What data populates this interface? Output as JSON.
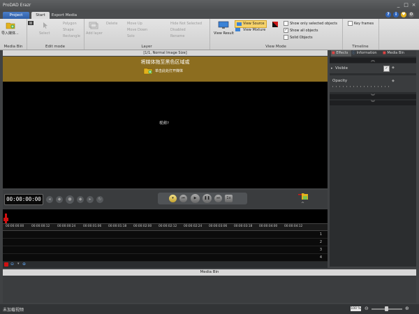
{
  "window": {
    "title": "ProDAD Erazr",
    "buttons": [
      "_",
      "□",
      "×"
    ]
  },
  "tabs": {
    "project": "Project",
    "start": "Start",
    "export": "Export Media"
  },
  "help_icons": [
    "?",
    "i",
    "♥",
    "⚙"
  ],
  "ribbon": {
    "media_bin": {
      "import": "导入媒体...",
      "title": "Media Bin"
    },
    "edit_mode": {
      "select": "Select",
      "polygon": "Polygon",
      "shape": "Shape",
      "rectangle": "Rectangle",
      "title": "Edit mode"
    },
    "layer": {
      "add_layer": "Add layer",
      "delete": "Delete",
      "move_up": "Move Up",
      "move_down": "Move Down",
      "solo": "Solo",
      "hide_all": "Hide Not Selected",
      "disabled": "Disabled",
      "rename": "Rename",
      "title": "Layer"
    },
    "view_mode": {
      "view_result": "View Result",
      "view_source": "View Source",
      "view_mixture": "View Mixture",
      "show_only_selected": "Show only selected objects",
      "show_all": "Show all objects",
      "solid_objects": "Solid Objects",
      "title": "View Mode"
    },
    "timeline": {
      "key_frames": "Key frames",
      "title": "Timeline"
    }
  },
  "preview": {
    "header": "[1/1, Normal Image Size]",
    "drop_text": "将媒体拖至黑色区域或",
    "open_media": "单击此处打开媒体",
    "video_label": "视频?"
  },
  "transport": {
    "timecode": "00:00:00:00",
    "speed_label": "1x"
  },
  "timeline": {
    "ticks": [
      "00:00:00:00",
      "00:00:00:12",
      "00:00:00:24",
      "00:00:01:06",
      "00:00:01:18",
      "00:00:02:00",
      "00:00:02:12",
      "00:00:02:24",
      "00:00:03:06",
      "00:00:03:18",
      "00:00:04:00",
      "00:00:04:12"
    ],
    "tracks": [
      "1",
      "2",
      "3",
      "4"
    ]
  },
  "right_panel": {
    "tabs": {
      "effects": "Effects",
      "information": "Information",
      "media_bin": "Media Bin"
    },
    "visible_label": "Visible",
    "opacity_label": "Opacity"
  },
  "media_bin": {
    "title": "Media Bin"
  },
  "status": {
    "left": "未加载视频",
    "zoom": "100 %"
  },
  "colors": {
    "accent_blue": "#3b6fbf",
    "drop_gold": "#8c6d1f",
    "playhead_red": "#d11010",
    "view_source_highlight": "#f6d36b"
  }
}
